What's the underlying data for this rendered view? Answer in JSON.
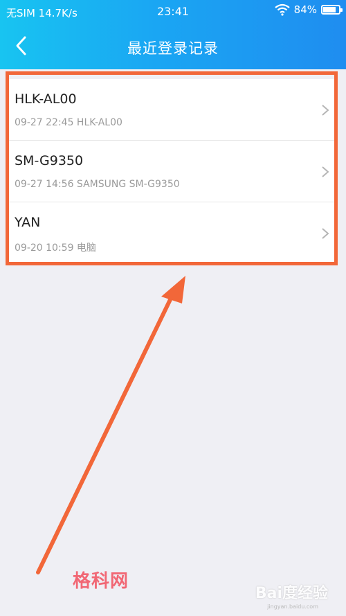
{
  "status_bar": {
    "carrier": "无SIM 14.7K/s",
    "time": "23:41",
    "battery": "84%",
    "battery_level": 0.84,
    "icons": [
      "wifi-icon",
      "battery-icon"
    ]
  },
  "nav": {
    "back_icon": "chevron-left-icon",
    "title": "最近登录记录"
  },
  "login_records": [
    {
      "device": "HLK-AL00",
      "detail": "09-27  22:45 HLK-AL00"
    },
    {
      "device": "SM-G9350",
      "detail": "09-27  14:56 SAMSUNG SM-G9350"
    },
    {
      "device": "YAN",
      "detail": "09-20  10:59 电脑"
    }
  ],
  "colors": {
    "header_start": "#18c4f1",
    "header_end": "#1f8df0",
    "annotation": "#f26739",
    "background": "#efeff4"
  },
  "watermarks": {
    "left": "格科网",
    "right": "Bai度经验",
    "url": "jingyan.baidu.com"
  }
}
